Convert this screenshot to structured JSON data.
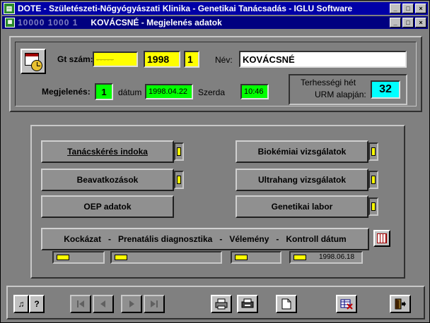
{
  "window": {
    "title": "DOTE - Születészeti-Nőgyógyászati Klinika - Genetikai Tanácsadás - IGLU Software",
    "controls": [
      "_",
      "□",
      "×"
    ]
  },
  "subwindow": {
    "record_no": "10000 1000 1",
    "title": "KOVÁCSNÉ  -  Megjelenés adatok",
    "controls": [
      "_",
      "□",
      "×"
    ]
  },
  "header": {
    "gt_label": "Gt szám:",
    "gt_ghost": "-----",
    "gt_year": "1998",
    "gt_no": "1",
    "nev_label": "Név:",
    "nev_value": "KOVÁCSNÉ",
    "megjelenes_label": "Megjelenés:",
    "megjelenes_value": "1",
    "datum_label": "dátum",
    "datum_value": "1998.04.22",
    "day_value": "Szerda",
    "time_value": "10:46",
    "terhesseg_label_1": "Terhességi hét",
    "terhesseg_label_2": "URM alapján:",
    "terhesseg_value": "32"
  },
  "buttons": {
    "tanacskeres": "Tanácskérés indoka",
    "beavatkozasok": "Beavatkozások",
    "oep": "OEP adatok",
    "biokemiai": "Biokémiai vizsgálatok",
    "ultrahang": "Ultrahang vizsgálatok",
    "genetikai": "Genetikai labor"
  },
  "bottom_bar": {
    "kockazat": "Kockázat",
    "sep1": "-",
    "prenatalis": "Prenatális diagnosztika",
    "sep2": "-",
    "velemeny": "Vélemény",
    "sep3": "-",
    "kontroll": "Kontroll dátum",
    "kontroll_date": "1998.06.18"
  },
  "toolbar": {
    "help_label": "?",
    "icons": [
      "music-icon",
      "help-icon",
      "first-record-icon",
      "prev-record-icon",
      "next-record-icon",
      "last-record-icon",
      "print-icon",
      "print-preview-icon",
      "new-document-icon",
      "delete-grid-icon",
      "exit-door-icon"
    ]
  },
  "colors": {
    "title_bar": "#0000a8",
    "sub_title_bar": "#000080",
    "yellow_field": "#ffff00",
    "green_field": "#00ff00",
    "cyan_field": "#00ffff",
    "panel_gray": "#808080"
  }
}
